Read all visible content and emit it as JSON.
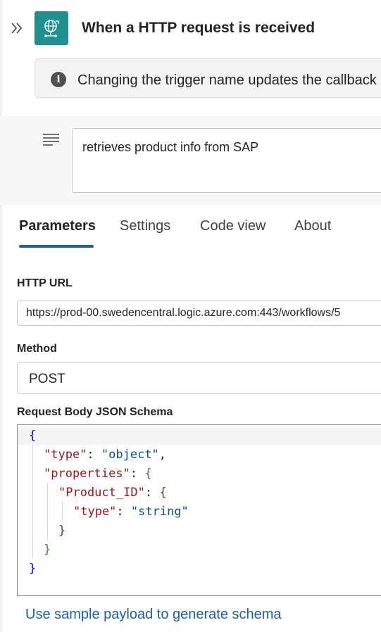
{
  "header": {
    "title": "When a HTTP request is received",
    "info_text": "Changing the trigger name updates the callback"
  },
  "description": {
    "value": "retrieves product info from SAP"
  },
  "tabs": [
    {
      "label": "Parameters",
      "active": true
    },
    {
      "label": "Settings",
      "active": false
    },
    {
      "label": "Code view",
      "active": false
    },
    {
      "label": "About",
      "active": false
    }
  ],
  "fields": {
    "http_url_label": "HTTP URL",
    "http_url_value": "https://prod-00.swedencentral.logic.azure.com:443/workflows/5",
    "method_label": "Method",
    "method_value": "POST",
    "schema_label": "Request Body JSON Schema"
  },
  "schema_code": {
    "open_brace": "{",
    "type_key": "\"type\"",
    "type_value": "\"object\"",
    "properties_key": "\"properties\"",
    "product_key": "\"Product_ID\"",
    "product_type_key": "\"type\"",
    "product_type_value": "\"string\"",
    "close_brace": "}"
  },
  "sample_payload_link": "Use sample payload to generate schema",
  "colors": {
    "accent": "#1a5fb4",
    "trigger_icon_bg": "#1f8f8f",
    "json_key": "#a31515",
    "json_string": "#0451a5"
  }
}
